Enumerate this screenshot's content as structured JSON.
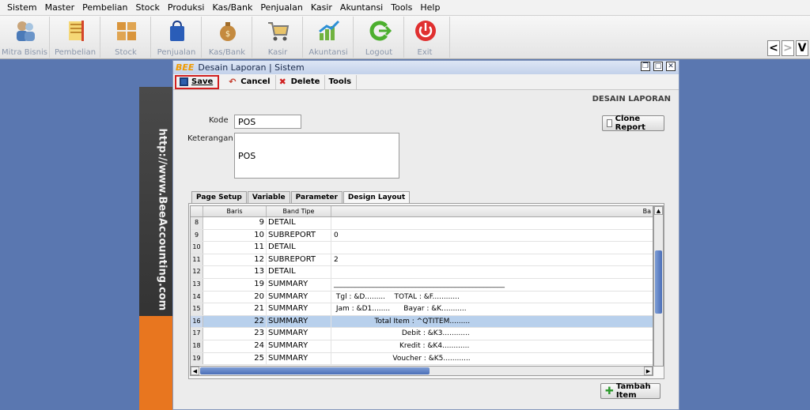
{
  "menu": [
    "Sistem",
    "Master",
    "Pembelian",
    "Stock",
    "Produksi",
    "Kas/Bank",
    "Penjualan",
    "Kasir",
    "Akuntansi",
    "Tools",
    "Help"
  ],
  "toolbar": [
    {
      "label": "Mitra Bisnis",
      "icon": "people-icon"
    },
    {
      "label": "Pembelian",
      "icon": "folder-icon"
    },
    {
      "label": "Stock",
      "icon": "boxes-icon"
    },
    {
      "label": "Penjualan",
      "icon": "bag-icon"
    },
    {
      "label": "Kas/Bank",
      "icon": "money-bag-icon"
    },
    {
      "label": "Kasir",
      "icon": "cart-icon"
    },
    {
      "label": "Akuntansi",
      "icon": "chart-up-icon"
    },
    {
      "label": "Logout",
      "icon": "logout-icon"
    },
    {
      "label": "Exit",
      "icon": "power-icon"
    }
  ],
  "nav": {
    "prev": "<",
    "next": ">",
    "more": "V"
  },
  "decor_text": "http://www.BeeAccounting.com",
  "window": {
    "logo": "BEE",
    "title": "Desain Laporan | Sistem",
    "section_title": "DESAIN LAPORAN"
  },
  "actions": {
    "save": "Save",
    "cancel": "Cancel",
    "delete": "Delete",
    "tools": "Tools"
  },
  "form": {
    "kode_label": "Kode",
    "kode_value": "POS",
    "keterangan_label": "Keterangan",
    "keterangan_value": "POS",
    "clone_button": "Clone Report"
  },
  "tabs": [
    "Page Setup",
    "Variable",
    "Parameter",
    "Design Layout"
  ],
  "active_tab": "Design Layout",
  "grid": {
    "columns": [
      "Baris",
      "Band Tipe",
      "Ba"
    ],
    "rows": [
      {
        "n": "8",
        "baris": "9",
        "band": "DETAIL",
        "text": ""
      },
      {
        "n": "9",
        "baris": "10",
        "band": "SUBREPORT",
        "text": "0"
      },
      {
        "n": "10",
        "baris": "11",
        "band": "DETAIL",
        "text": ""
      },
      {
        "n": "11",
        "baris": "12",
        "band": "SUBREPORT",
        "text": "2"
      },
      {
        "n": "12",
        "baris": "13",
        "band": "DETAIL",
        "text": ""
      },
      {
        "n": "13",
        "baris": "19",
        "band": "SUMMARY",
        "text": "________________________________________________"
      },
      {
        "n": "14",
        "baris": "20",
        "band": "SUMMARY",
        "text": " Tgl : &D.........    TOTAL : &F............"
      },
      {
        "n": "15",
        "baris": "21",
        "band": "SUMMARY",
        "text": " Jam : &D1........      Bayar : &K..........."
      },
      {
        "n": "16",
        "baris": "22",
        "band": "SUMMARY",
        "text": "                  Total Item : ^QTITEM........."
      },
      {
        "n": "17",
        "baris": "23",
        "band": "SUMMARY",
        "text": "                              Debit : &K3............"
      },
      {
        "n": "18",
        "baris": "24",
        "band": "SUMMARY",
        "text": "                             Kredit : &K4............"
      },
      {
        "n": "19",
        "baris": "25",
        "band": "SUMMARY",
        "text": "                          Voucher : &K5............"
      }
    ]
  },
  "tambah_button": "Tambah Item",
  "colors": {
    "desktop": "#5a77b0",
    "selected_row": "#b8d0ec",
    "save_highlight": "#d12020"
  }
}
